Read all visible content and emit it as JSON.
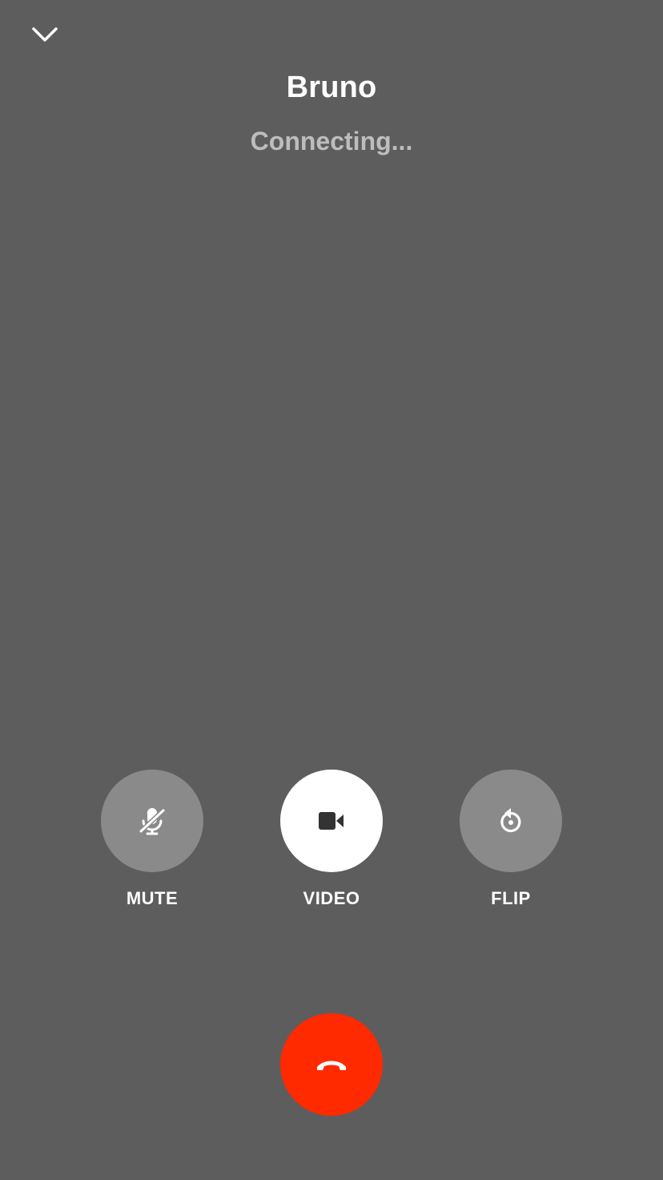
{
  "call": {
    "caller_name": "Bruno",
    "status": "Connecting..."
  },
  "controls": {
    "mute": {
      "label": "MUTE",
      "icon": "mic-off-icon",
      "active": false
    },
    "video": {
      "label": "VIDEO",
      "icon": "video-camera-icon",
      "active": true
    },
    "flip": {
      "label": "FLIP",
      "icon": "flip-camera-icon",
      "active": false
    }
  },
  "end_call": {
    "icon": "hang-up-icon"
  },
  "header": {
    "minimize_icon": "chevron-down-icon"
  },
  "colors": {
    "background": "#5d5d5d",
    "control_inactive": "#8a8a8a",
    "control_active": "#ffffff",
    "end_call": "#ff2a00",
    "status_text": "#bdbdbd"
  }
}
